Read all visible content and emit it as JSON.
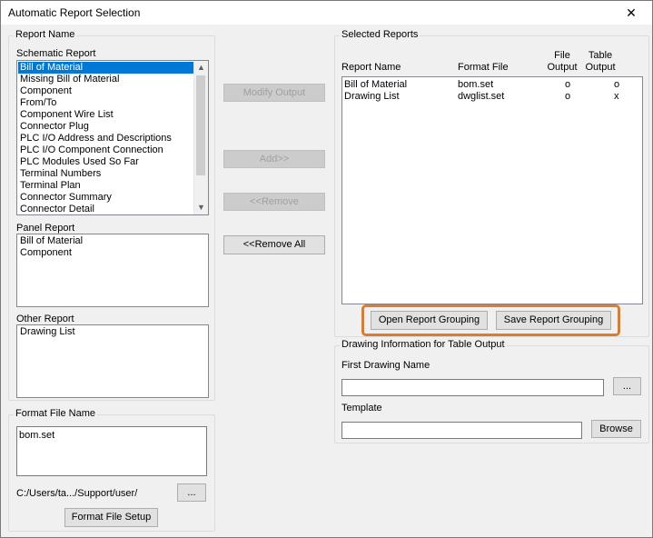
{
  "window": {
    "title": "Automatic Report Selection",
    "close_glyph": "✕"
  },
  "report_name": {
    "group_label": "Report Name",
    "schematic_label": "Schematic Report",
    "schematic_items": [
      "Bill of Material",
      "Missing Bill of Material",
      "Component",
      "From/To",
      "Component Wire List",
      "Connector Plug",
      "PLC I/O Address and Descriptions",
      "PLC I/O Component Connection",
      "PLC Modules Used So Far",
      "Terminal Numbers",
      "Terminal Plan",
      "Connector Summary",
      "Connector Detail"
    ],
    "schematic_selected": "Bill of Material",
    "panel_label": "Panel Report",
    "panel_items": [
      "Bill of Material",
      "Component"
    ],
    "other_label": "Other Report",
    "other_items": [
      "Drawing List"
    ]
  },
  "format_file": {
    "group_label": "Format File Name",
    "value": "bom.set",
    "path": "C:/Users/ta.../Support/user/",
    "browse_label": "...",
    "setup_label": "Format File Setup"
  },
  "middle_buttons": {
    "modify": "Modify Output",
    "add": "Add>>",
    "remove": "<<Remove",
    "remove_all": "<<Remove All"
  },
  "selected_reports": {
    "group_label": "Selected Reports",
    "col_report_name": "Report Name",
    "col_format_file": "Format File",
    "col_file_output_1": "File",
    "col_file_output_2": "Output",
    "col_table_output_1": "Table",
    "col_table_output_2": "Output",
    "rows": [
      {
        "name": "Bill of Material",
        "format": "bom.set",
        "file": "o",
        "table": "o"
      },
      {
        "name": "Drawing List",
        "format": "dwglist.set",
        "file": "o",
        "table": "x"
      }
    ],
    "open_grouping": "Open Report Grouping",
    "save_grouping": "Save Report Grouping",
    "highlight_color": "#e07b27"
  },
  "drawing_info": {
    "group_label": "Drawing Information for Table Output",
    "first_drawing_label": "First Drawing Name",
    "first_drawing_value": "",
    "first_drawing_browse": "...",
    "template_label": "Template",
    "template_value": "",
    "template_browse": "Browse"
  },
  "icons": {
    "scroll_up": "▲",
    "scroll_down": "▼"
  }
}
